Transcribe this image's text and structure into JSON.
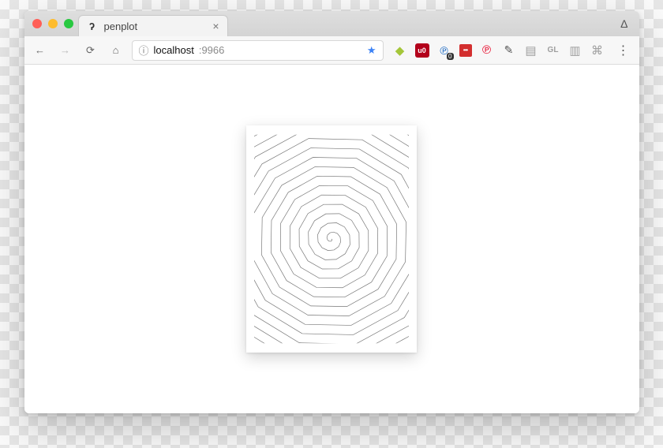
{
  "window": {
    "traffic_lights": {
      "close": "#ff5f57",
      "minimize": "#febc2e",
      "zoom": "#28c840"
    }
  },
  "tab": {
    "favicon_glyph": "ʔ",
    "title": "penplot",
    "close_glyph": "×"
  },
  "anonymous_indicator": "Δ",
  "toolbar": {
    "back": "←",
    "forward": "→",
    "reload": "⟳",
    "home": "⌂",
    "info_glyph": "ⓘ",
    "url_host": "localhost",
    "url_port": ":9966",
    "star_glyph": "★",
    "extensions": [
      {
        "name": "android-icon",
        "glyph": "◆"
      },
      {
        "name": "ublock-icon",
        "glyph": "u0"
      },
      {
        "name": "privacy-icon",
        "glyph": "℗",
        "badge": "0"
      },
      {
        "name": "lastpass-icon",
        "glyph": "•••"
      },
      {
        "name": "pinterest-icon",
        "glyph": "℗"
      },
      {
        "name": "eyedropper-icon",
        "glyph": "✎"
      },
      {
        "name": "reader-icon",
        "glyph": "▤"
      },
      {
        "name": "gl-icon",
        "glyph": "GL"
      },
      {
        "name": "readlater-icon",
        "glyph": "▥"
      },
      {
        "name": "screenshot-icon",
        "glyph": "⌘"
      }
    ],
    "menu_glyph": "⋮"
  },
  "content": {
    "artwork_name": "spiral-polygon-plot"
  }
}
